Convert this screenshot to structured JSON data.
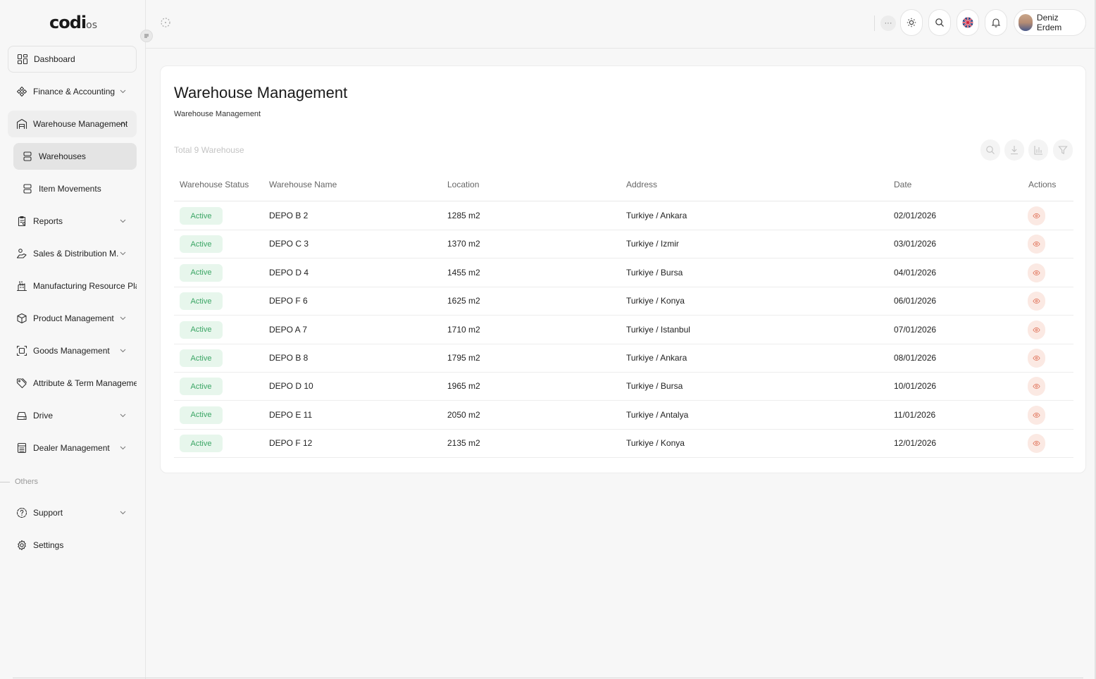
{
  "brand": {
    "logo_main": "codi",
    "logo_suffix": "os"
  },
  "sidebar": {
    "items": [
      {
        "label": "Dashboard",
        "icon": "dashboard-icon",
        "has_chevron": false
      },
      {
        "label": "Finance & Accounting",
        "icon": "finance-icon",
        "has_chevron": true
      },
      {
        "label": "Warehouse Management",
        "icon": "warehouse-icon",
        "has_chevron": true,
        "expanded": true
      },
      {
        "label": "Warehouses",
        "icon": "server-icon",
        "sub": true,
        "selected": true
      },
      {
        "label": "Item Movements",
        "icon": "server-icon",
        "sub": true
      },
      {
        "label": "Reports",
        "icon": "reports-icon",
        "has_chevron": true
      },
      {
        "label": "Sales & Distribution M.",
        "icon": "sales-icon",
        "has_chevron": true
      },
      {
        "label": "Manufacturing Resource Planni",
        "icon": "factory-icon",
        "has_chevron": false
      },
      {
        "label": "Product Management",
        "icon": "box-icon",
        "has_chevron": true
      },
      {
        "label": "Goods Management",
        "icon": "goods-icon",
        "has_chevron": true
      },
      {
        "label": "Attribute & Term Management",
        "icon": "tag-icon",
        "has_chevron": false
      },
      {
        "label": "Drive",
        "icon": "drive-icon",
        "has_chevron": true
      },
      {
        "label": "Dealer Management",
        "icon": "dealer-icon",
        "has_chevron": true
      }
    ],
    "others_label": "Others",
    "others_items": [
      {
        "label": "Support",
        "icon": "support-icon",
        "has_chevron": true
      },
      {
        "label": "Settings",
        "icon": "gear-icon",
        "has_chevron": false
      }
    ]
  },
  "topbar": {
    "more_label": "···",
    "user_name": "Deniz Erdem"
  },
  "page": {
    "title": "Warehouse Management",
    "breadcrumb": "Warehouse Management",
    "total_label": "Total 9 Warehouse"
  },
  "table": {
    "columns": [
      "Warehouse Status",
      "Warehouse Name",
      "Location",
      "Address",
      "Date",
      "Actions"
    ],
    "rows": [
      {
        "status": "Active",
        "name": "DEPO B 2",
        "location": "1285 m2",
        "address": "Turkiye / Ankara",
        "date": "02/01/2026"
      },
      {
        "status": "Active",
        "name": "DEPO C 3",
        "location": "1370 m2",
        "address": "Turkiye / Izmir",
        "date": "03/01/2026"
      },
      {
        "status": "Active",
        "name": "DEPO D 4",
        "location": "1455 m2",
        "address": "Turkiye / Bursa",
        "date": "04/01/2026"
      },
      {
        "status": "Active",
        "name": "DEPO F 6",
        "location": "1625 m2",
        "address": "Turkiye / Konya",
        "date": "06/01/2026"
      },
      {
        "status": "Active",
        "name": "DEPO A 7",
        "location": "1710 m2",
        "address": "Turkiye / Istanbul",
        "date": "07/01/2026"
      },
      {
        "status": "Active",
        "name": "DEPO B 8",
        "location": "1795 m2",
        "address": "Turkiye / Ankara",
        "date": "08/01/2026"
      },
      {
        "status": "Active",
        "name": "DEPO D 10",
        "location": "1965 m2",
        "address": "Turkiye / Bursa",
        "date": "10/01/2026"
      },
      {
        "status": "Active",
        "name": "DEPO E 11",
        "location": "2050 m2",
        "address": "Turkiye / Antalya",
        "date": "11/01/2026"
      },
      {
        "status": "Active",
        "name": "DEPO F 12",
        "location": "2135 m2",
        "address": "Turkiye / Konya",
        "date": "12/01/2026"
      }
    ]
  },
  "colors": {
    "status_active_bg": "#e7f6ec",
    "status_active_text": "#3aa564",
    "action_bg": "#fbe9e3",
    "action_icon": "#e0735a"
  }
}
